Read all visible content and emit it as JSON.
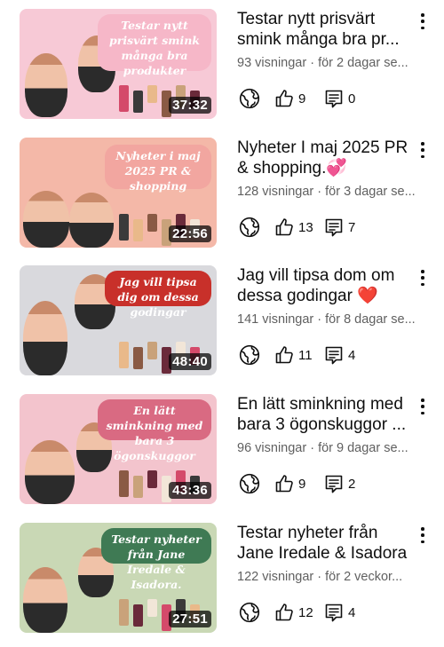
{
  "videos": [
    {
      "thumb_text": "Testar nytt prisvärt smink många bra produkter",
      "duration": "37:32",
      "title": "Testar nytt prisvärt smink många bra pr...",
      "meta": "93 visningar · för 2 dagar se...",
      "likes": "9",
      "comments": "0",
      "colors": {
        "bg": "#f7c9d6",
        "banner_bg": "#f6b7c8",
        "banner_fg": "#ffffff"
      }
    },
    {
      "thumb_text": "Nyheter i maj 2025 PR & shopping",
      "duration": "22:56",
      "title": "Nyheter I maj 2025 PR & shopping.💞",
      "meta": "128 visningar · för 3 dagar se...",
      "likes": "13",
      "comments": "7",
      "colors": {
        "bg": "#f4b8a8",
        "banner_bg": "#f2a6a0",
        "banner_fg": "#ffffff"
      }
    },
    {
      "thumb_text": "Jag vill tipsa dig om dessa godingar",
      "duration": "48:40",
      "title": "Jag vill tipsa dom om dessa godingar ❤️",
      "meta": "141 visningar · för 8 dagar se...",
      "likes": "11",
      "comments": "4",
      "colors": {
        "bg": "#d9d9dd",
        "banner_bg": "#c8302a",
        "banner_fg": "#ffffff"
      }
    },
    {
      "thumb_text": "En lätt sminkning med bara 3 ögonskuggor",
      "duration": "43:36",
      "title": "En lätt sminkning med bara 3 ögonskuggor ...",
      "meta": "96 visningar · för 9 dagar se...",
      "likes": "9",
      "comments": "2",
      "colors": {
        "bg": "#f3c4cd",
        "banner_bg": "#d96a82",
        "banner_fg": "#ffffff"
      }
    },
    {
      "thumb_text": "Testar nyheter från Jane Iredale & Isadora.",
      "duration": "27:51",
      "title": "Testar nyheter från Jane Iredale & Isadora",
      "meta": "122 visningar · för 2 veckor...",
      "likes": "12",
      "comments": "4",
      "colors": {
        "bg": "#c9d8b5",
        "banner_bg": "#3f7a54",
        "banner_fg": "#ffffff"
      }
    }
  ],
  "icons": {
    "visibility": "globe-icon",
    "likes": "thumbs-up-icon",
    "comments": "comment-icon",
    "menu": "more-vert-icon"
  }
}
